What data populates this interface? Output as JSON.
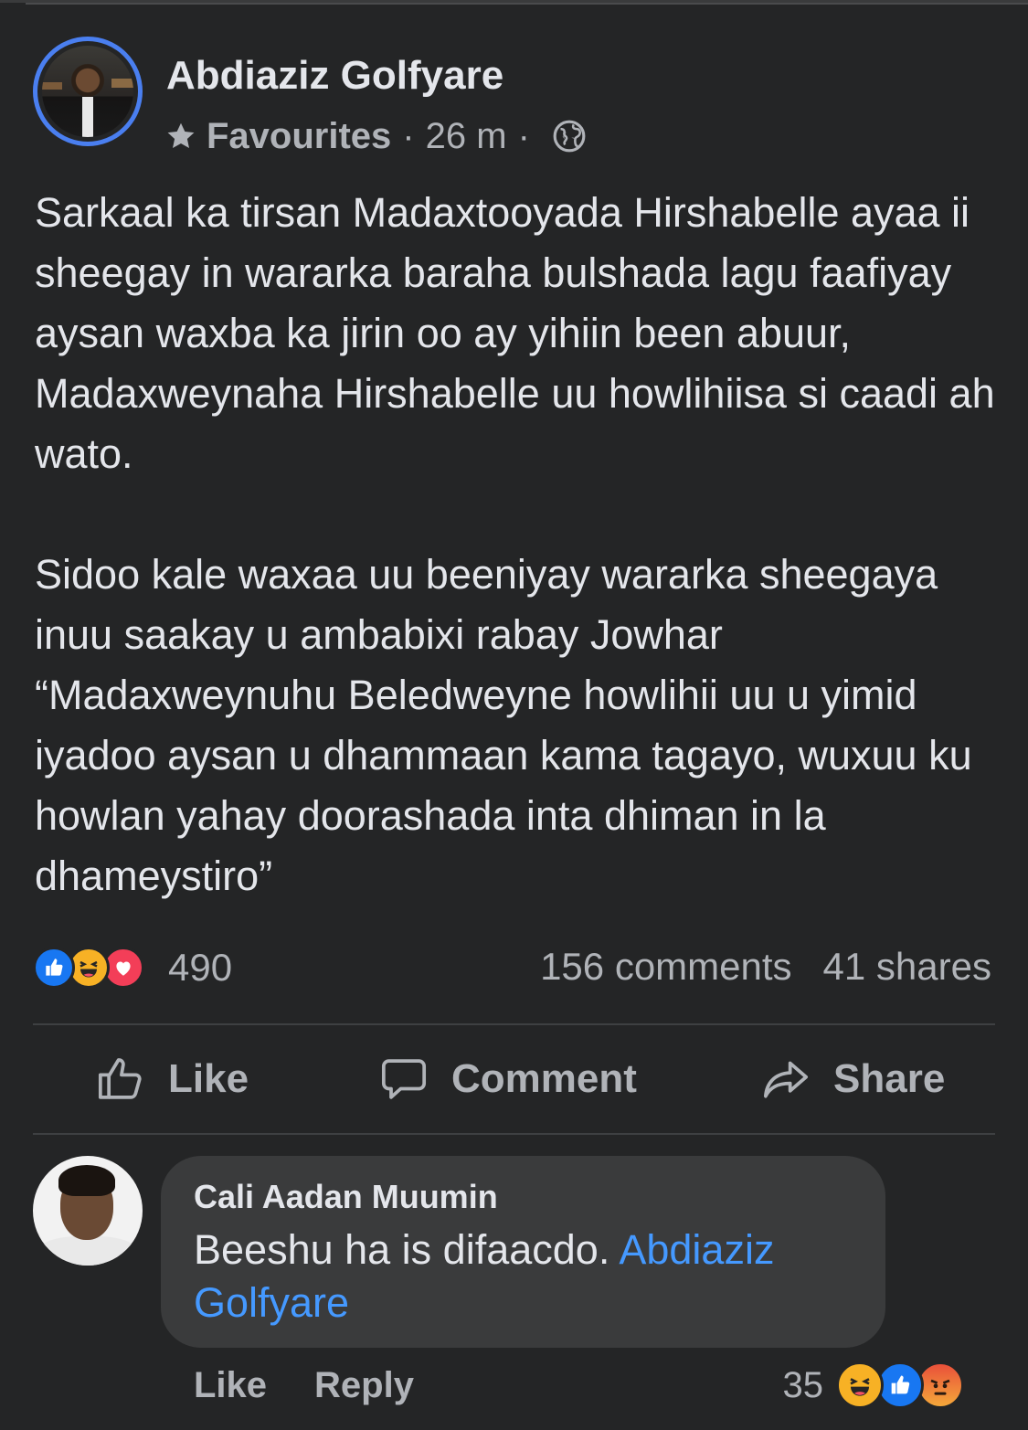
{
  "post": {
    "author": "Abdiaziz Golfyare",
    "badge": "Favourites",
    "separator": "·",
    "time": "26 m",
    "privacy_icon": "globe-icon",
    "paragraph1": "Sarkaal ka tirsan Madaxtooyada Hirshabelle ayaa ii sheegay in wararka baraha bulshada lagu faafiyay aysan waxba ka jirin oo ay yihiin been abuur, Madaxweynaha Hirshabelle uu howlihiisa si caadi ah wato.",
    "paragraph2": "Sidoo kale waxaa uu beeniyay wararka sheegaya inuu saakay u ambabixi rabay Jowhar “Madaxweynuhu Beledweyne howlihii uu u yimid iyadoo aysan u dhammaan kama tagayo, wuxuu ku howlan yahay doorashada inta dhiman in la dhameystiro”"
  },
  "stats": {
    "reactions_count": "490",
    "reaction_icons": [
      "like-icon",
      "haha-icon",
      "love-icon"
    ],
    "comments": "156 comments",
    "shares": "41 shares"
  },
  "actions": {
    "like": "Like",
    "comment": "Comment",
    "share": "Share"
  },
  "comment": {
    "author": "Cali Aadan Muumin",
    "text": "Beeshu ha is difaacdo.",
    "mention": "Abdiaziz Golfyare",
    "like_label": "Like",
    "reply_label": "Reply",
    "reaction_count": "35",
    "reaction_icons": [
      "haha-icon",
      "like-icon",
      "angry-icon"
    ]
  },
  "colors": {
    "background": "#242526",
    "text": "#e4e6eb",
    "secondary_text": "#b0b3b8",
    "bubble": "#3a3b3c",
    "mention": "#4599ff",
    "avatar_ring": "#4a7ff0"
  }
}
